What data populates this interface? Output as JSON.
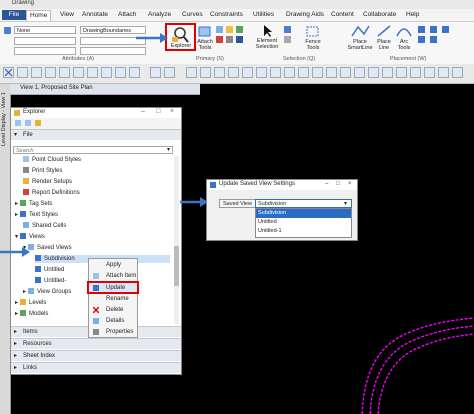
{
  "window": {
    "title": "Drawing"
  },
  "ribbon_tabs": [
    "File",
    "Home",
    "View",
    "Annotate",
    "Attach",
    "Analyze",
    "Curves",
    "Constraints",
    "Utilities",
    "Drawing Aids",
    "Content",
    "Collaborate",
    "Help"
  ],
  "ribbon": {
    "level_value": "None",
    "model_value": "DrawingBoundaries",
    "group_attributes": "Attributes (A)",
    "group_primary": "Primary (S)",
    "group_selection": "Selection (Q)",
    "group_placement": "Placement (W)",
    "explorer_label": "Explorer",
    "attach_tools_label": "Attach Tools",
    "element_selection_label": "Element Selection",
    "fence_tools_label": "Fence Tools",
    "place_smartline_label": "Place SmartLine",
    "place_line_label": "Place Line",
    "arc_tools_label": "Arc Tools"
  },
  "view": {
    "title": "View 1, Proposed Site Plan",
    "side_label": "Level Display - View 1"
  },
  "explorer": {
    "title": "Explorer",
    "file_section": "File",
    "search_placeholder": "Search",
    "tree": [
      "Point Cloud Styles",
      "Print Styles",
      "Render Setups",
      "Report Definitions",
      "Tag Sets",
      "Text Styles",
      "Shared Cells",
      "Views",
      "Saved Views",
      "Subdivision",
      "Untitled",
      "Untitled-",
      "View Groups",
      "Levels",
      "Models"
    ],
    "sections": [
      "Items",
      "Resources",
      "Sheet Index",
      "Links"
    ]
  },
  "context_menu": {
    "items": [
      "Apply",
      "Attach Item",
      "Update",
      "Rename",
      "Delete",
      "Details",
      "Properties"
    ]
  },
  "dialog": {
    "title": "Update Saved View Settings",
    "field_label": "Saved View",
    "selected": "Subdivision",
    "options": [
      "Subdivision",
      "Untitled",
      "Untitled-1"
    ]
  },
  "colors": {
    "accent": "#2b5797",
    "highlight": "#e00000",
    "arrow": "#3a73c8",
    "road": "#ff00ff"
  }
}
